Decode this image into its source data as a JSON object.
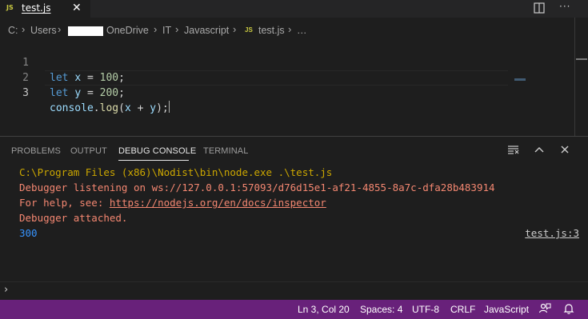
{
  "tab": {
    "file_icon": "JS",
    "name": "test.js",
    "close_glyph": "✕"
  },
  "breadcrumb": {
    "drive": "C:",
    "users": "Users",
    "onedrive": "OneDrive",
    "it": "IT",
    "javascript": "Javascript",
    "file_icon": "JS",
    "file": "test.js",
    "more": "…"
  },
  "editor": {
    "lines": [
      {
        "number": "1",
        "keyword": "let",
        "name": "x",
        "value": "100"
      },
      {
        "number": "2",
        "keyword": "let",
        "name": "y",
        "value": "200"
      },
      {
        "number": "3",
        "object": "console",
        "method": "log",
        "arg_a": "x",
        "arg_b": "y"
      }
    ]
  },
  "panel": {
    "tabs": [
      "PROBLEMS",
      "OUTPUT",
      "DEBUG CONSOLE",
      "TERMINAL"
    ],
    "active_tab": "DEBUG CONSOLE",
    "output": {
      "command": "C:\\Program Files (x86)\\Nodist\\bin\\node.exe .\\test.js",
      "debugger": "Debugger listening on ws://127.0.0.1:57093/d76d15e1-af21-4855-8a7c-dfa28b483914",
      "help_prefix": "For help, see: ",
      "help_link": "https://nodejs.org/en/docs/inspector",
      "attached": "Debugger attached.",
      "result": "300",
      "result_source": "test.js:3"
    },
    "repl_prompt": "›"
  },
  "statusbar": {
    "position": "Ln 3, Col 20",
    "spaces": "Spaces: 4",
    "encoding": "UTF-8",
    "eol": "CRLF",
    "language": "JavaScript"
  },
  "colors": {
    "statusbar_bg": "#68217a",
    "editor_bg": "#1e1e1e",
    "keyword": "#569cd6",
    "number": "#b5cea8",
    "output_error": "#f48771",
    "output_command": "#cca700",
    "output_result": "#3794ff"
  },
  "icons": {
    "tab_close": "close-icon",
    "split_editor": "split-editor-icon",
    "more_actions": "more-actions-icon",
    "breadcrumb_separator": "chevron-right-icon",
    "clear_console": "clear-console-icon",
    "maximize_panel": "chevron-up-icon",
    "close_panel": "close-icon",
    "feedback": "feedback-icon",
    "notifications": "bell-icon"
  }
}
